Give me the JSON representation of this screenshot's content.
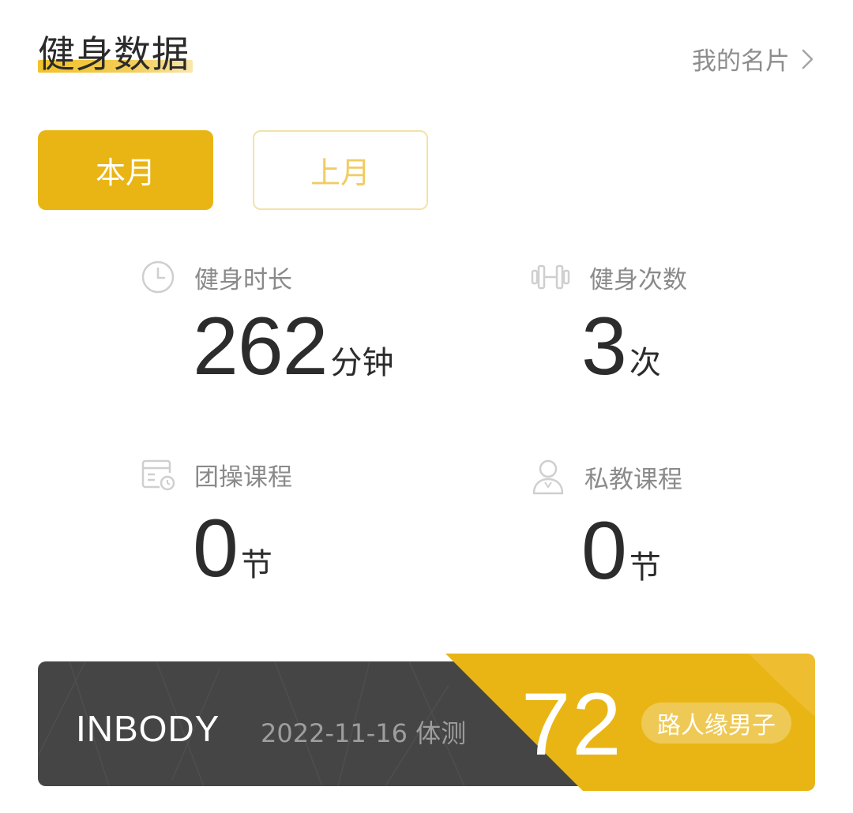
{
  "header": {
    "title": "健身数据",
    "card_link": "我的名片"
  },
  "tabs": [
    {
      "label": "本月",
      "active": true
    },
    {
      "label": "上月",
      "active": false
    }
  ],
  "stats": [
    {
      "label": "健身时长",
      "value": "262",
      "unit": "分钟",
      "icon": "clock-icon"
    },
    {
      "label": "健身次数",
      "value": "3",
      "unit": "次",
      "icon": "dumbbell-icon"
    },
    {
      "label": "团操课程",
      "value": "0",
      "unit": "节",
      "icon": "calendar-clock-icon"
    },
    {
      "label": "私教课程",
      "value": "0",
      "unit": "节",
      "icon": "trainer-icon"
    }
  ],
  "inbody": {
    "label": "INBODY",
    "date": "2022-11-16 体测",
    "score": "72",
    "badge": "路人缘男子"
  },
  "colors": {
    "accent": "#e9b514",
    "dark_card": "#454545",
    "muted_text": "#8a8a8a"
  }
}
